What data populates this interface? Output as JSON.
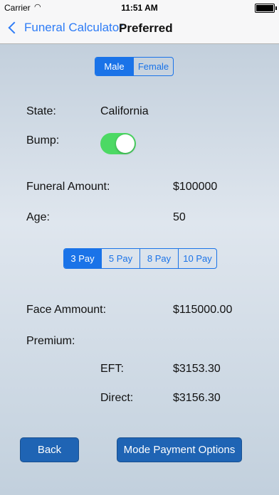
{
  "status_bar": {
    "carrier": "Carrier",
    "time": "11:51 AM"
  },
  "nav": {
    "back_label": "Funeral Calculator",
    "title": "Preferred"
  },
  "gender": {
    "options": [
      "Male",
      "Female"
    ],
    "selected": "Male"
  },
  "form": {
    "state_label": "State:",
    "state_value": "California",
    "bump_label": "Bump:",
    "bump_on": true,
    "funeral_label": "Funeral Amount:",
    "funeral_value": "$100000",
    "age_label": "Age:",
    "age_value": "50"
  },
  "pay": {
    "options": [
      "3 Pay",
      "5 Pay",
      "8 Pay",
      "10 Pay"
    ],
    "selected": "3 Pay"
  },
  "results": {
    "face_label": "Face Ammount:",
    "face_value": "$115000.00",
    "premium_label": "Premium:",
    "eft_label": "EFT:",
    "eft_value": "$3153.30",
    "direct_label": "Direct:",
    "direct_value": "$3156.30"
  },
  "buttons": {
    "back": "Back",
    "mode": "Mode Payment Options"
  },
  "colors": {
    "accent": "#1a73e8",
    "toggle_on": "#4cd964",
    "button": "#1f64b4"
  }
}
